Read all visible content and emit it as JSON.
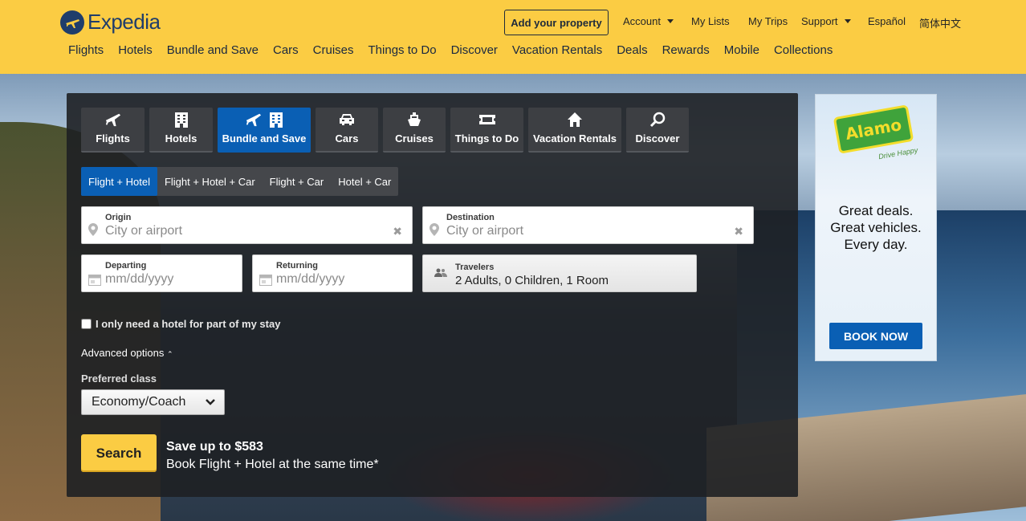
{
  "brand": {
    "name": "Expedia"
  },
  "header": {
    "add_property": "Add your property",
    "util_links": [
      {
        "label": "Account",
        "dropdown": true
      },
      {
        "label": "My Lists",
        "dropdown": false
      },
      {
        "label": "My Trips",
        "dropdown": false
      },
      {
        "label": "Support",
        "dropdown": true
      },
      {
        "label": "Español",
        "dropdown": false
      },
      {
        "label": "简体中文",
        "dropdown": false
      }
    ],
    "nav": [
      "Flights",
      "Hotels",
      "Bundle and Save",
      "Cars",
      "Cruises",
      "Things to Do",
      "Discover",
      "Vacation Rentals",
      "Deals",
      "Rewards",
      "Mobile",
      "Collections"
    ]
  },
  "search": {
    "tabs": [
      {
        "label": "Flights",
        "icon": "plane-icon",
        "active": false
      },
      {
        "label": "Hotels",
        "icon": "building-icon",
        "active": false
      },
      {
        "label": "Bundle and Save",
        "icon": "plane-building-icon",
        "active": true
      },
      {
        "label": "Cars",
        "icon": "car-icon",
        "active": false
      },
      {
        "label": "Cruises",
        "icon": "ship-icon",
        "active": false
      },
      {
        "label": "Things to Do",
        "icon": "ticket-icon",
        "active": false
      },
      {
        "label": "Vacation Rentals",
        "icon": "house-icon",
        "active": false
      },
      {
        "label": "Discover",
        "icon": "search-icon",
        "active": false
      }
    ],
    "subtabs": [
      "Flight + Hotel",
      "Flight + Hotel + Car",
      "Flight + Car",
      "Hotel + Car"
    ],
    "active_subtab": 0,
    "origin": {
      "label": "Origin",
      "placeholder": "City or airport",
      "value": ""
    },
    "destination": {
      "label": "Destination",
      "placeholder": "City or airport",
      "value": ""
    },
    "departing": {
      "label": "Departing",
      "placeholder": "mm/dd/yyyy",
      "value": ""
    },
    "returning": {
      "label": "Returning",
      "placeholder": "mm/dd/yyyy",
      "value": ""
    },
    "travelers": {
      "label": "Travelers",
      "value": "2 Adults, 0 Children, 1 Room"
    },
    "partial_stay": {
      "label": "I only need a hotel for part of my stay",
      "checked": false
    },
    "advanced_options": "Advanced options",
    "preferred_class": {
      "label": "Preferred class",
      "value": "Economy/Coach"
    },
    "search_button": "Search",
    "save_title": "Save up to $583",
    "save_subtitle": "Book Flight + Hotel at the same time*"
  },
  "ad": {
    "brand": "Alamo",
    "tagline": "Drive Happy",
    "text_lines": [
      "Great deals.",
      "Great vehicles.",
      "Every day."
    ],
    "cta": "BOOK NOW"
  },
  "colors": {
    "header_bg": "#fbcc43",
    "active_tab": "#0a5fb4",
    "search_button": "#fbcc43",
    "brand_navy": "#1f3d6b"
  }
}
